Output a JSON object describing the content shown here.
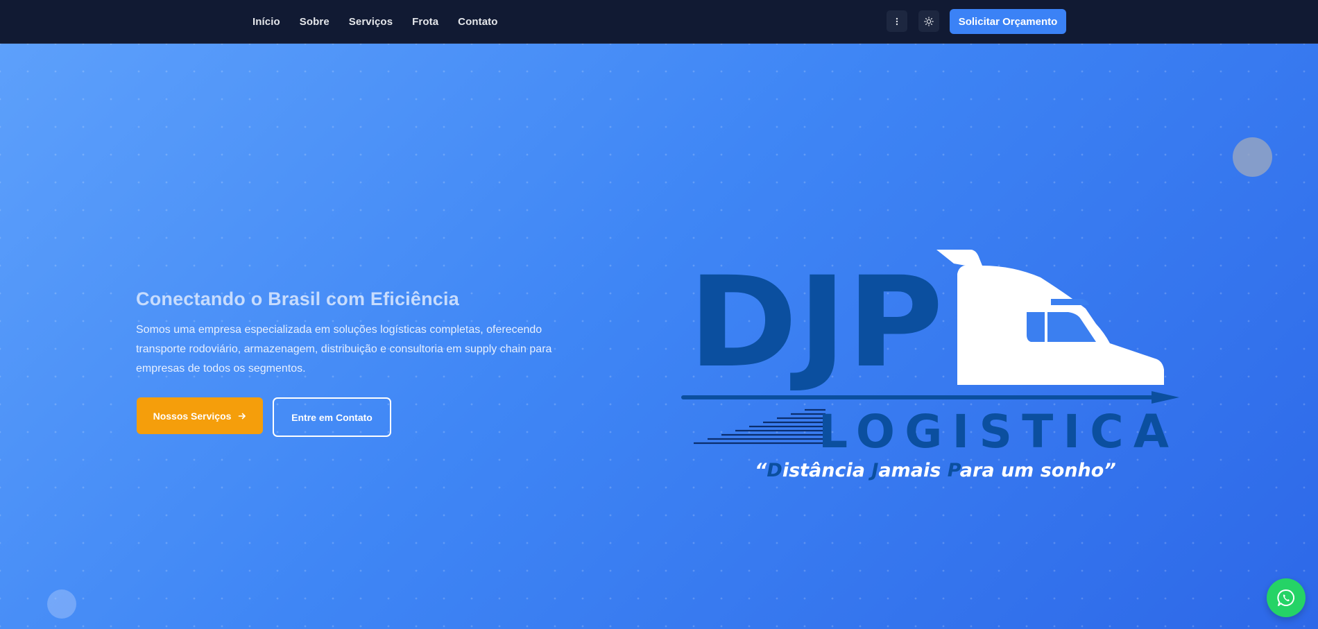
{
  "nav": {
    "links": [
      "Início",
      "Sobre",
      "Serviços",
      "Frota",
      "Contato"
    ],
    "cta_label": "Solicitar Orçamento",
    "more_icon": "more-vertical-icon",
    "theme_icon": "sun-icon"
  },
  "hero": {
    "title": "Conectando o Brasil com Eficiência",
    "description": "Somos uma empresa especializada em soluções logísticas completas, oferecendo transporte rodoviário, armazenagem, distribuição e consultoria em supply chain para empresas de todos os segmentos.",
    "primary_button": "Nossos Serviços",
    "secondary_button": "Entre em Contato"
  },
  "logo": {
    "brand": "DJP",
    "word": "LOGISTICA",
    "slogan_prefix": "“",
    "slogan_parts": [
      "D",
      "istância ",
      "J",
      "amais ",
      "P",
      "ara um sonho",
      "”"
    ]
  },
  "colors": {
    "nav_bg": "#111a33",
    "accent": "#3b82f6",
    "primary_button": "#f59e0b",
    "logo_dark": "#0b4f9f",
    "whatsapp": "#25d366"
  },
  "floating": {
    "icon": "whatsapp-icon"
  }
}
